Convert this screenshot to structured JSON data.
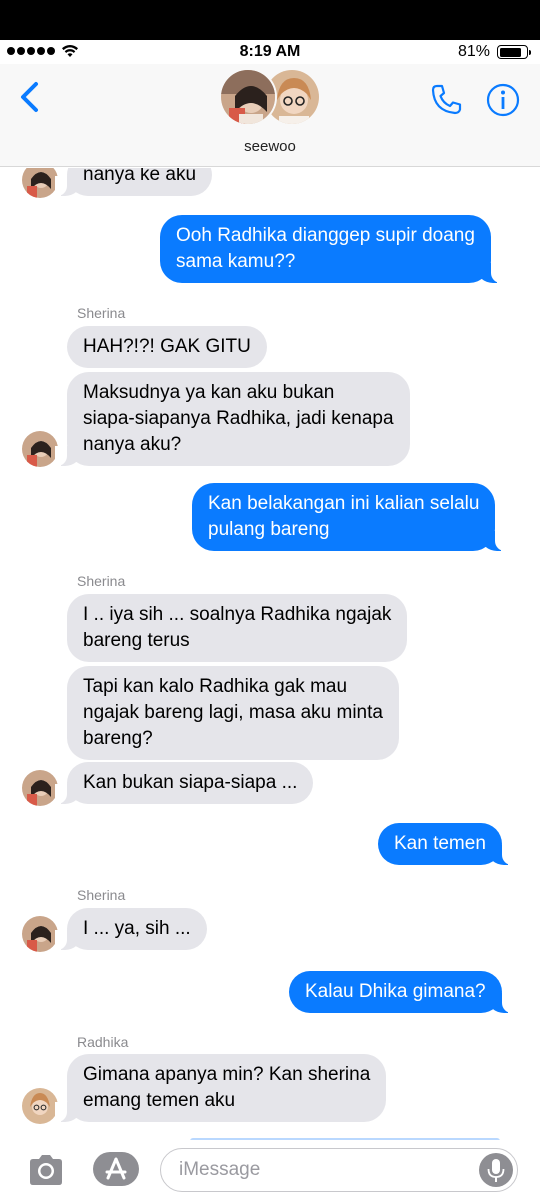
{
  "status_bar": {
    "time": "8:19 AM",
    "battery": "81%"
  },
  "header": {
    "contact_name": "seewoo"
  },
  "thread": {
    "m0": "nanya ke aku",
    "m1a": "Ooh Radhika dianggep supir doang",
    "m1b": "sama kamu??",
    "s1": "Sherina",
    "m2": "HAH?!?! GAK GITU",
    "m3a": "Maksudnya ya kan aku bukan",
    "m3b": "siapa-siapanya Radhika, jadi kenapa",
    "m3c": "nanya aku?",
    "m4a": "Kan belakangan ini kalian selalu",
    "m4b": "pulang bareng",
    "s2": "Sherina",
    "m5a": "I .. iya sih ... soalnya Radhika ngajak",
    "m5b": "bareng terus",
    "m6a": "Tapi kan kalo Radhika gak mau",
    "m6b": "ngajak bareng lagi, masa aku minta",
    "m6c": "bareng?",
    "m7": "Kan bukan siapa-siapa ...",
    "m8": "Kan temen",
    "s3": "Sherina",
    "m9": "I ... ya, sih ...",
    "m10": "Kalau Dhika gimana?",
    "s4": "Radhika",
    "m11a": "Gimana apanya min? Kan sherina",
    "m11b": "emang temen aku"
  },
  "input": {
    "placeholder": "iMessage"
  },
  "colors": {
    "accent": "#0a7bff",
    "incoming": "#e5e5ea",
    "outgoing_text": "#ffffff"
  },
  "icons": [
    "back-chevron-icon",
    "phone-icon",
    "info-icon",
    "camera-icon",
    "app-store-icon",
    "microphone-icon"
  ]
}
